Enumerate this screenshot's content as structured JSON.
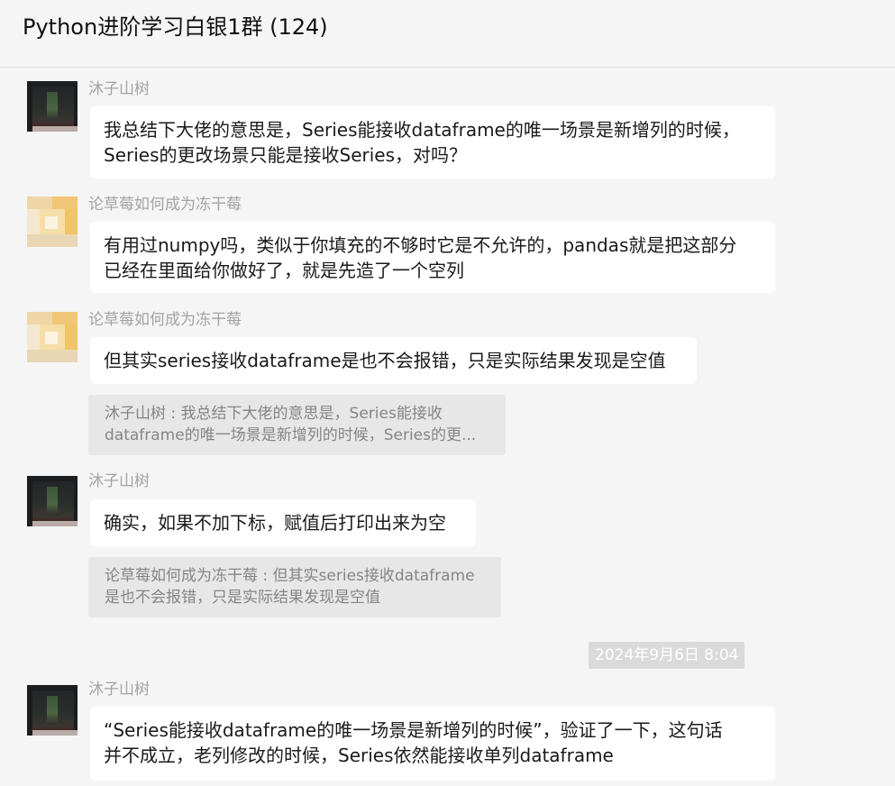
{
  "window": {
    "title": "Python进阶学习白银1群 (124)"
  },
  "messages": [
    {
      "sender": "沐子山树",
      "avatar": "dark-tree-avatar",
      "text": "我总结下大佬的意思是，Series能接收dataframe的唯一场景是新增列的时候，\nSeries的更改场景只能是接收Series，对吗？"
    },
    {
      "sender": "论草莓如何成为冻干莓",
      "avatar": "yellow-pixel-avatar",
      "text": "有用过numpy吗，类似于你填充的不够时它是不允许的，pandas就是把这部分\n已经在里面给你做好了，就是先造了一个空列"
    },
    {
      "sender": "论草莓如何成为冻干莓",
      "avatar": "yellow-pixel-avatar",
      "text": "但其实series接收dataframe是也不会报错，只是实际结果发现是空值",
      "quote": "沐子山树 : 我总结下大佬的意思是，Series能接收\ndataframe的唯一场景是新增列的时候，Series的更..."
    },
    {
      "sender": "沐子山树",
      "avatar": "dark-tree-avatar",
      "text": "确实，如果不加下标，赋值后打印出来为空",
      "quote": "论草莓如何成为冻干莓 : 但其实series接收dataframe\n是也不会报错，只是实际结果发现是空值"
    },
    {
      "sender": "沐子山树",
      "avatar": "dark-tree-avatar",
      "text": "“Series能接收dataframe的唯一场景是新增列的时候”，验证了一下，这句话\n并不成立，老列修改的时候，Series依然能接收单列dataframe"
    }
  ],
  "timestamp": "2024年9月6日 8:04",
  "colors": {
    "background": "#f5f5f5",
    "bubble": "#ffffff",
    "quote_bg": "#e7e7e7",
    "sender_text": "#a3a3a3",
    "timestamp_bg": "#dadada"
  }
}
